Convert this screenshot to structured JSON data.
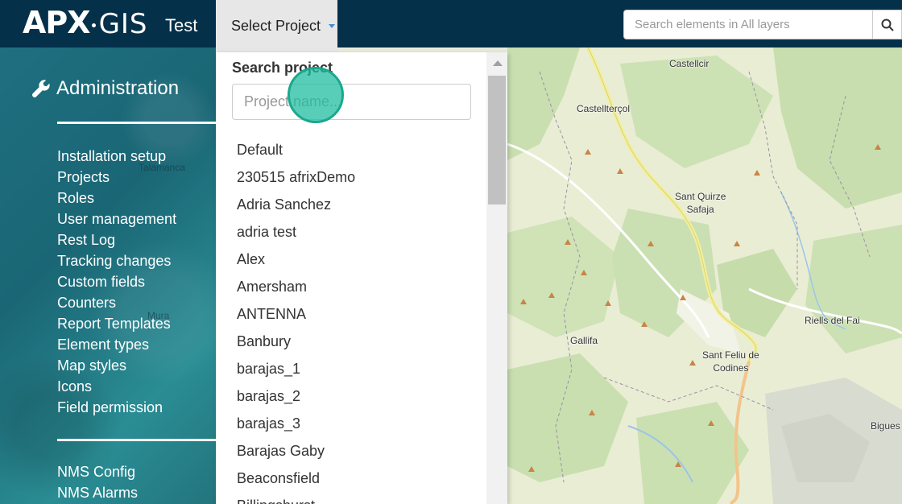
{
  "header": {
    "logo_left": "APX",
    "logo_x": "X",
    "logo_right": "GIS",
    "project_name": "Test",
    "select_project_label": "Select Project",
    "search_placeholder": "Search elements in All layers"
  },
  "sidebar": {
    "heading": "Administration",
    "menu_group_1": [
      "Installation setup",
      "Projects",
      "Roles",
      "User management",
      "Rest Log",
      "Tracking changes",
      "Custom fields",
      "Counters",
      "Report Templates",
      "Element types",
      "Map styles",
      "Icons",
      "Field permission"
    ],
    "menu_group_2": [
      "NMS Config",
      "NMS Alarms"
    ],
    "map_labels": [
      "Talamanca",
      "Mura"
    ]
  },
  "dropdown": {
    "title": "Search project",
    "input_placeholder": "Project name...",
    "projects": [
      "Default",
      "230515 afrixDemo",
      "Adria Sanchez",
      "adria test",
      "Alex",
      "Amersham",
      "ANTENNA",
      "Banbury",
      "barajas_1",
      "barajas_2",
      "barajas_3",
      "Barajas Gaby",
      "Beaconsfield",
      "Billingshurst"
    ]
  },
  "map": {
    "labels": [
      "Castellcir",
      "Castellterçol",
      "Sant Quirze\nSafaja",
      "Riells del Fai",
      "Gallifa",
      "Sant Feliu de\nCodines",
      "Bigues"
    ]
  },
  "colors": {
    "topbar": "#053049",
    "sidebar": "#1e6f80",
    "accent": "#1aa88e",
    "caret": "#4a8bd0"
  }
}
